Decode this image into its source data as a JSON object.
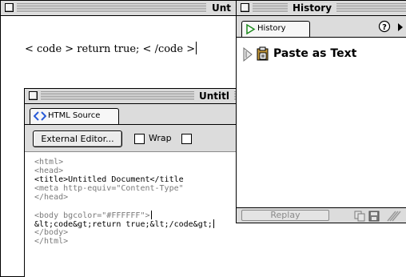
{
  "doc_window": {
    "title": "Unt",
    "content_text": "< code > return true; < /code >"
  },
  "source_window": {
    "title": "Untitl",
    "tab_label": "HTML Source",
    "external_editor_label": "External Editor...",
    "wrap_label": "Wrap",
    "code_lines": [
      "<html>",
      "<head>",
      "<title>Untitled Document</title",
      "<meta http-equiv=\"Content-Type\"",
      "</head>",
      "",
      "<body bgcolor=\"#FFFFFF\">",
      "&lt;code&gt;return true;&lt;/code&gt;",
      "</body>",
      "</html>"
    ]
  },
  "history_panel": {
    "title": "History",
    "tab_label": "History",
    "items": [
      {
        "label": "Paste as Text"
      }
    ],
    "replay_label": "Replay"
  },
  "icons": {
    "help": "help-icon",
    "scroll_right": "play-right-icon",
    "paste": "clipboard-icon",
    "tag": "code-tag-icon",
    "copy": "copy-icon",
    "save": "save-icon"
  }
}
